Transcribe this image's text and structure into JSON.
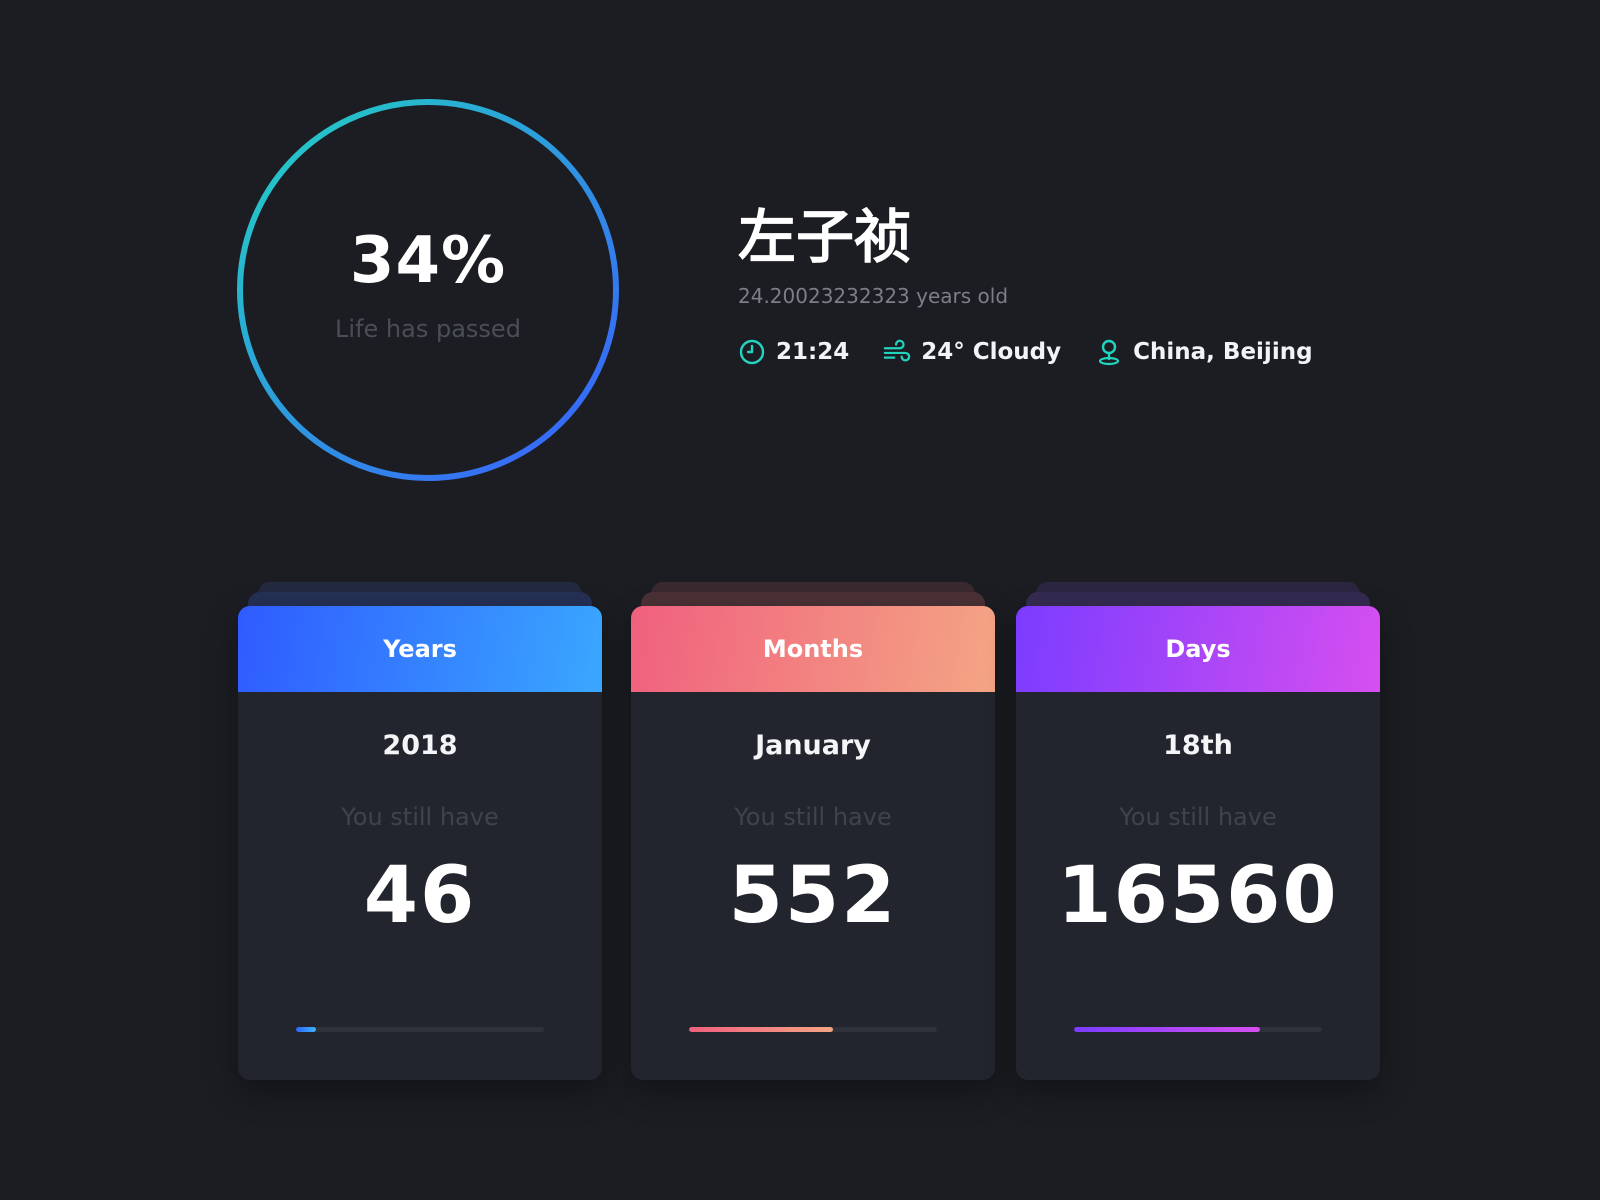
{
  "life": {
    "percent_label": "34%",
    "percent_value": 0.34,
    "caption": "Life has passed",
    "ring_colors": [
      "#22d3c0",
      "#3a5bff"
    ]
  },
  "profile": {
    "name": "左子祯",
    "age": "24.20023232323 years old",
    "meta": {
      "time": "21:24",
      "weather": "24° Cloudy",
      "location": "China, Beijing"
    },
    "icons": [
      "clock-icon",
      "wind-icon",
      "location-pin-icon"
    ],
    "accent": "#22d3c0"
  },
  "cards": [
    {
      "title": "Years",
      "current": "2018",
      "hint": "You still have",
      "remaining": "46",
      "progress": 0.08,
      "colors": [
        "#2f5bff",
        "#3aa7ff"
      ]
    },
    {
      "title": "Months",
      "current": "January",
      "hint": "You still have",
      "remaining": "552",
      "progress": 0.58,
      "colors": [
        "#f0607e",
        "#f4a584"
      ]
    },
    {
      "title": "Days",
      "current": "18th",
      "hint": "You still have",
      "remaining": "16560",
      "progress": 0.75,
      "colors": [
        "#7b3cff",
        "#d64ff0"
      ]
    }
  ]
}
